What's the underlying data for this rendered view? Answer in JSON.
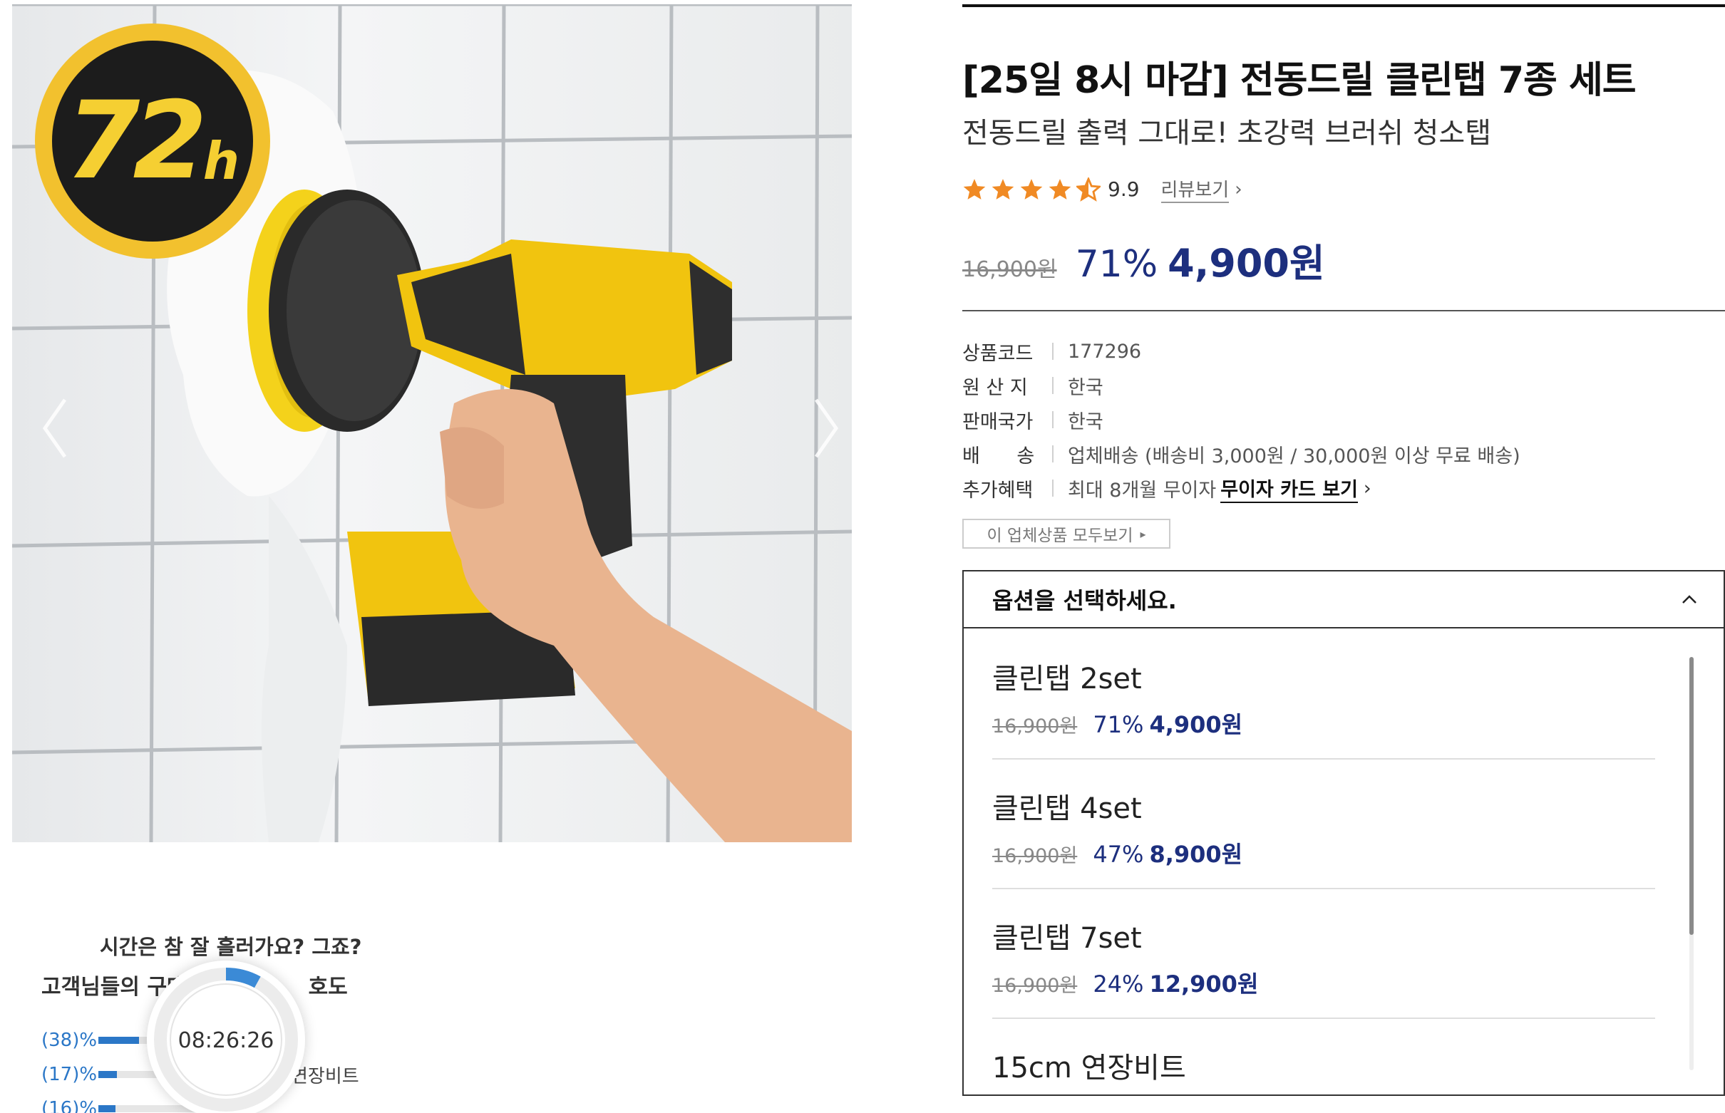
{
  "badge": {
    "number": "72",
    "unit": "h"
  },
  "gallery": {
    "prev_icon": "chevron-left-icon",
    "next_icon": "chevron-right-icon"
  },
  "product": {
    "title": "[25일 8시 마감] 전동드릴 클린탭 7종 세트",
    "subtitle": "전동드릴 출력 그대로! 초강력 브러쉬 청소탭",
    "rating_value": 4.5,
    "rating_score": "9.9",
    "review_link": "리뷰보기",
    "original_price": "16,900원",
    "discount_percent": "71%",
    "sale_price": "4,900원"
  },
  "info": {
    "code_label": "상품코드",
    "code_value": "177296",
    "origin_label": "원 산 지",
    "origin_value": "한국",
    "country_label": "판매국가",
    "country_value": "한국",
    "shipping_label": "배      송",
    "shipping_value": "업체배송 (배송비 3,000원 / 30,000원 이상 무료 배송)",
    "benefit_label": "추가혜택",
    "benefit_value": "최대 8개월 무이자",
    "benefit_link": "무이자 카드 보기"
  },
  "vendor_button": "이 업체상품 모두보기",
  "options": {
    "header": "옵션을 선택하세요.",
    "items": [
      {
        "name": "클린탭 2set",
        "original": "16,900원",
        "percent": "71%",
        "price": "4,900원"
      },
      {
        "name": "클린탭 4set",
        "original": "16,900원",
        "percent": "47%",
        "price": "8,900원"
      },
      {
        "name": "클린탭 7set",
        "original": "16,900원",
        "percent": "24%",
        "price": "12,900원"
      },
      {
        "name": "15cm 연장비트"
      }
    ],
    "scroll_fraction": 0.67
  },
  "purchase_widget": {
    "title": "시간은 참 잘 흘러가요? 그죠?",
    "subtitle_start": "고객님들의 구매",
    "subtitle_end": "호도",
    "timer": "08:26:26",
    "timer_progress": 0.08,
    "stats": [
      {
        "label": "(38)%",
        "fraction": 0.38
      },
      {
        "label": "(17)%",
        "fraction": 0.17
      },
      {
        "label": "(16)%",
        "fraction": 0.16
      }
    ],
    "stat_name_2": "연장비트"
  },
  "colors": {
    "accent_navy": "#1d2f7e",
    "star_orange": "#f08a24",
    "badge_yellow": "#f2c12e",
    "stat_blue": "#2b77c7"
  }
}
